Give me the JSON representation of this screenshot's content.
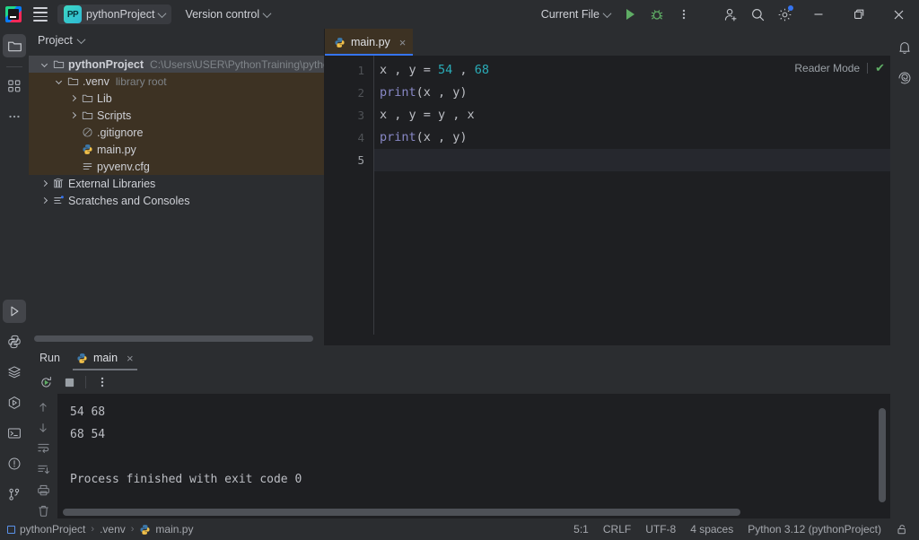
{
  "titlebar": {
    "project_badge": "PP",
    "project_name": "pythonProject",
    "version_control": "Version control",
    "run_config": "Current File",
    "icons": {
      "app_logo": "intellij-logo-icon",
      "main_menu": "hamburger-menu-icon",
      "run": "run-icon",
      "debug": "debug-icon",
      "more": "more-options-icon",
      "add_user": "add-user-icon",
      "search": "search-icon",
      "settings": "settings-gear-icon",
      "minimize": "minimize-icon",
      "maximize": "maximize-icon",
      "close": "close-icon"
    }
  },
  "left_rail": {
    "top": [
      {
        "name": "project-tool-window",
        "icon": "folder-icon",
        "active": true
      },
      {
        "name": "structure-tool-window",
        "icon": "structure-icon",
        "active": false
      },
      {
        "name": "more-tool-windows",
        "icon": "ellipsis-icon",
        "active": false
      }
    ],
    "bottom": [
      {
        "name": "run-tool-window",
        "icon": "run-triangle-icon",
        "active": true
      },
      {
        "name": "python-console",
        "icon": "python-icon",
        "active": false
      },
      {
        "name": "database-tool-window",
        "icon": "layers-icon",
        "active": false
      },
      {
        "name": "services-tool-window",
        "icon": "services-icon",
        "active": false
      },
      {
        "name": "terminal-tool-window",
        "icon": "terminal-icon",
        "active": false
      },
      {
        "name": "problems-tool-window",
        "icon": "problems-icon",
        "active": false
      },
      {
        "name": "version-control-tool-window",
        "icon": "branch-icon",
        "active": false
      }
    ]
  },
  "right_rail": [
    {
      "name": "notifications",
      "icon": "bell-icon"
    },
    {
      "name": "ai-assistant",
      "icon": "ai-spiral-icon"
    }
  ],
  "project_panel": {
    "title": "Project",
    "tree": [
      {
        "label": "pythonProject",
        "hint": "C:\\Users\\USER\\PythonTraining\\pythonProject",
        "indent": 0,
        "arrow": "down",
        "icon": "folder-icon",
        "bold": true,
        "selected": true,
        "venvbg": false
      },
      {
        "label": ".venv",
        "hint": "library root",
        "indent": 1,
        "arrow": "down",
        "icon": "folder-icon",
        "bold": false,
        "selected": false,
        "venvbg": true
      },
      {
        "label": "Lib",
        "hint": "",
        "indent": 2,
        "arrow": "right",
        "icon": "folder-icon",
        "bold": false,
        "selected": false,
        "venvbg": true
      },
      {
        "label": "Scripts",
        "hint": "",
        "indent": 2,
        "arrow": "right",
        "icon": "folder-icon",
        "bold": false,
        "selected": false,
        "venvbg": true
      },
      {
        "label": ".gitignore",
        "hint": "",
        "indent": 2,
        "arrow": "none",
        "icon": "gitignore-icon",
        "bold": false,
        "selected": false,
        "venvbg": true
      },
      {
        "label": "main.py",
        "hint": "",
        "indent": 2,
        "arrow": "none",
        "icon": "python-icon",
        "bold": false,
        "selected": false,
        "venvbg": true
      },
      {
        "label": "pyvenv.cfg",
        "hint": "",
        "indent": 2,
        "arrow": "none",
        "icon": "cfg-icon",
        "bold": false,
        "selected": false,
        "venvbg": true
      },
      {
        "label": "External Libraries",
        "hint": "",
        "indent": 0,
        "arrow": "right",
        "icon": "library-icon",
        "bold": false,
        "selected": false,
        "venvbg": false
      },
      {
        "label": "Scratches and Consoles",
        "hint": "",
        "indent": 0,
        "arrow": "right",
        "icon": "scratches-icon",
        "bold": false,
        "selected": false,
        "venvbg": false
      }
    ]
  },
  "editor": {
    "tab": {
      "label": "main.py",
      "icon": "python-icon",
      "close": "×"
    },
    "reader_mode": "Reader Mode",
    "reader_check": "✔",
    "lines": [
      {
        "num": "1",
        "segments": [
          {
            "t": "x , y = ",
            "c": "plain"
          },
          {
            "t": "54",
            "c": "num"
          },
          {
            "t": " , ",
            "c": "plain"
          },
          {
            "t": "68",
            "c": "num"
          }
        ],
        "current": false
      },
      {
        "num": "2",
        "segments": [
          {
            "t": "print",
            "c": "fn"
          },
          {
            "t": "(x , y)",
            "c": "plain"
          }
        ],
        "current": false
      },
      {
        "num": "3",
        "segments": [
          {
            "t": "x , y = y , x",
            "c": "plain"
          }
        ],
        "current": false
      },
      {
        "num": "4",
        "segments": [
          {
            "t": "print",
            "c": "fn"
          },
          {
            "t": "(x , y)",
            "c": "plain"
          }
        ],
        "current": false
      },
      {
        "num": "5",
        "segments": [
          {
            "t": "",
            "c": "plain"
          }
        ],
        "current": true
      }
    ]
  },
  "run_panel": {
    "title": "Run",
    "tab_label": "main",
    "tab_icon": "python-icon",
    "tab_close": "×",
    "toolbar": [
      {
        "name": "rerun-button",
        "icon": "rerun-icon"
      },
      {
        "name": "stop-button",
        "icon": "stop-icon"
      },
      {
        "name": "more-run-options",
        "icon": "more-options-icon"
      }
    ],
    "console_rail": [
      {
        "name": "previous-occurrence",
        "icon": "arrow-up-icon"
      },
      {
        "name": "next-occurrence",
        "icon": "arrow-down-icon"
      },
      {
        "name": "soft-wrap-toggle",
        "icon": "soft-wrap-icon"
      },
      {
        "name": "scroll-to-end",
        "icon": "scroll-to-end-icon"
      },
      {
        "name": "print-button",
        "icon": "print-icon"
      },
      {
        "name": "clear-console",
        "icon": "trash-icon"
      }
    ],
    "console_lines": [
      "54 68",
      "68 54",
      "",
      "Process finished with exit code 0"
    ]
  },
  "statusbar": {
    "breadcrumbs": [
      {
        "label": "pythonProject",
        "icon": "project-square-icon"
      },
      {
        "label": ".venv",
        "icon": "none"
      },
      {
        "label": "main.py",
        "icon": "python-icon"
      }
    ],
    "separator": "›",
    "caret_position": "5:1",
    "line_separator": "CRLF",
    "encoding": "UTF-8",
    "indent": "4 spaces",
    "interpreter": "Python 3.12 (pythonProject)",
    "lock_icon": "unlocked-icon"
  },
  "colors": {
    "accent_blue": "#3574f0",
    "run_green": "#5fad65",
    "number_teal": "#2aacb8",
    "keyword_violet": "#8888c6",
    "venv_highlight": "#3d3223"
  }
}
